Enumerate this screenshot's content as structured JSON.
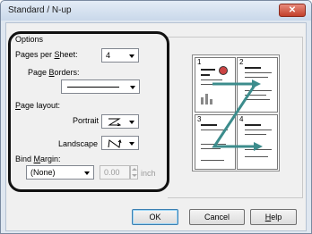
{
  "window": {
    "title": "Standard / N-up",
    "close_label": "✕"
  },
  "options": {
    "group_label": "Options",
    "pages_per_sheet": {
      "label_pre": "Pages per ",
      "label_ul": "S",
      "label_post": "heet:",
      "value": "4"
    },
    "page_borders": {
      "label_pre": "Page ",
      "label_ul": "B",
      "label_post": "orders:"
    },
    "page_layout": {
      "label_ul": "P",
      "label_post": "age layout:",
      "portrait_label": "Portrait",
      "landscape_label": "Landscape"
    },
    "bind_margin": {
      "label_pre": "Bind ",
      "label_ul": "M",
      "label_post": "argin:",
      "selected": "(None)",
      "value": "0.00",
      "unit": "inch"
    }
  },
  "preview": {
    "page_numbers": [
      "1",
      "2",
      "3",
      "4"
    ]
  },
  "buttons": {
    "ok": "OK",
    "cancel": "Cancel",
    "help_ul": "H",
    "help_post": "elp"
  },
  "colors": {
    "highlight_frame": "#111111",
    "arrow": "#3c8c8c",
    "titlebar_close": "#c2402a"
  }
}
